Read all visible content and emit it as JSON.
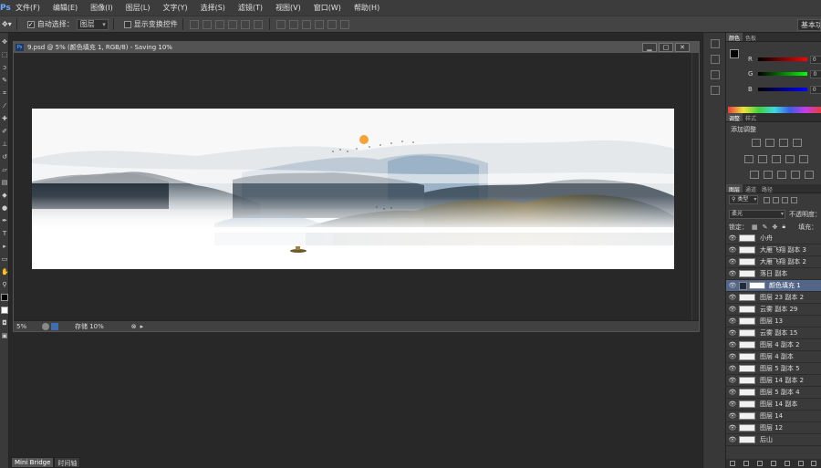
{
  "menubar": {
    "logo": "Ps",
    "items": [
      "文件(F)",
      "编辑(E)",
      "图像(I)",
      "图层(L)",
      "文字(Y)",
      "选择(S)",
      "滤镜(T)",
      "视图(V)",
      "窗口(W)",
      "帮助(H)"
    ]
  },
  "options": {
    "auto_select_label": "自动选择：",
    "auto_select_value": "图层",
    "show_transform_label": "显示变换控件",
    "workspace": "基本功能"
  },
  "document": {
    "title": "9.psd @ 5% (颜色填充 1, RGB/8) - Saving 10%",
    "zoom": "5%",
    "status": "存储 10%"
  },
  "bottom_tabs": [
    "Mini Bridge",
    "时间轴"
  ],
  "panels": {
    "color_tabs": [
      "颜色",
      "色板"
    ],
    "color_rows": [
      {
        "channel": "R",
        "value": "0"
      },
      {
        "channel": "G",
        "value": "0"
      },
      {
        "channel": "B",
        "value": "0"
      }
    ],
    "adjust_tabs": [
      "调整",
      "样式"
    ],
    "adjust_title": "添加调整",
    "layers_tabs": [
      "图层",
      "通道",
      "路径"
    ],
    "filter_kind": "类型",
    "blend_mode": "柔光",
    "opacity_label": "不透明度：",
    "lock_label": "锁定：",
    "fill_label": "填充：",
    "layers": [
      {
        "name": "小舟",
        "selected": false,
        "fill": false
      },
      {
        "name": "大雁飞翔 副本 3",
        "selected": false,
        "fill": false
      },
      {
        "name": "大雁飞翔 副本 2",
        "selected": false,
        "fill": false
      },
      {
        "name": "落日 副本",
        "selected": false,
        "fill": false
      },
      {
        "name": "颜色填充 1",
        "selected": true,
        "fill": true
      },
      {
        "name": "图层 23 副本 2",
        "selected": false,
        "fill": false
      },
      {
        "name": "云雾 副本 29",
        "selected": false,
        "fill": false
      },
      {
        "name": "图层 13",
        "selected": false,
        "fill": false
      },
      {
        "name": "云雾 副本 15",
        "selected": false,
        "fill": false
      },
      {
        "name": "图层 4 副本 2",
        "selected": false,
        "fill": false
      },
      {
        "name": "图层 4 副本",
        "selected": false,
        "fill": false
      },
      {
        "name": "图层 5 副本 5",
        "selected": false,
        "fill": false
      },
      {
        "name": "图层 14 副本 2",
        "selected": false,
        "fill": false
      },
      {
        "name": "图层 5 副本 4",
        "selected": false,
        "fill": false
      },
      {
        "name": "图层 14 副本",
        "selected": false,
        "fill": false
      },
      {
        "name": "图层 14",
        "selected": false,
        "fill": false
      },
      {
        "name": "图层 12",
        "selected": false,
        "fill": false
      },
      {
        "name": "后山",
        "selected": false,
        "fill": false
      }
    ]
  },
  "colors": {
    "accent_selected": "#546687",
    "sun": "#f2a33a"
  }
}
